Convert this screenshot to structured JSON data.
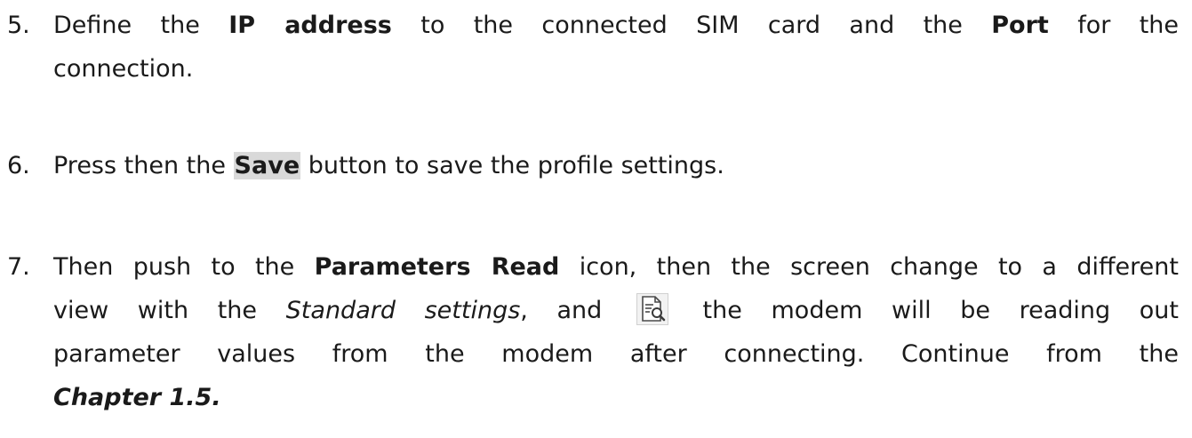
{
  "steps": [
    {
      "number": "5.",
      "t1": "Define the ",
      "b1": "IP address",
      "t2": " to the connected SIM card and the ",
      "b2": "Port",
      "t3": " for the",
      "t4": "connection."
    },
    {
      "number": "6.",
      "t1": "Press then the ",
      "save": "Save",
      "t2": " button to save the profile settings."
    },
    {
      "number": "7.",
      "t1": "Then push to the ",
      "b1": "Parameters Read",
      "t2": " icon, then the screen change to a different",
      "t3": "view with the ",
      "i1": "Standard settings",
      "t4": ", and ",
      "icon": "document-search-icon",
      "t5": " the modem will be reading out",
      "t6": "parameter values from the modem after connecting. Continue from the",
      "chapter": "Chapter 1.5."
    }
  ]
}
